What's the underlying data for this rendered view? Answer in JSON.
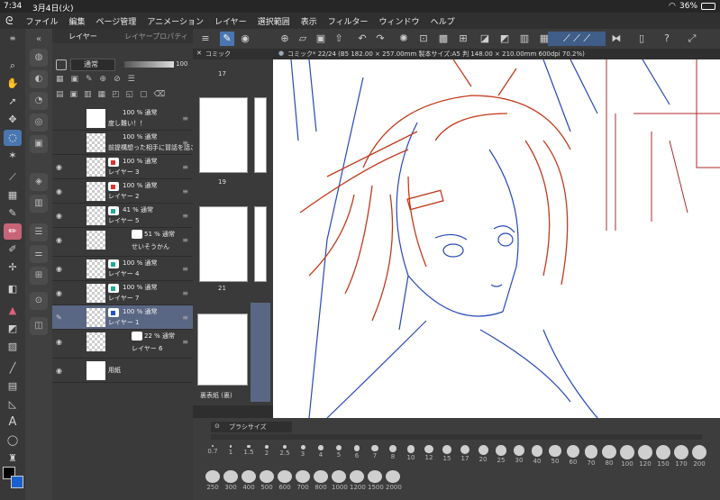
{
  "status": {
    "time": "7:34",
    "date": "3月4日(火)",
    "battery": "36%"
  },
  "menu": [
    "ファイル",
    "編集",
    "ページ管理",
    "アニメーション",
    "レイヤー",
    "選択範囲",
    "表示",
    "フィルター",
    "ウィンドウ",
    "ヘルプ"
  ],
  "layer_panel": {
    "tab_layer": "レイヤー",
    "tab_property": "レイヤープロパティ",
    "blend_mode": "通常",
    "opacity": "100"
  },
  "layers": [
    {
      "line1": "100 % 通常",
      "line2": "度し難い！！"
    },
    {
      "line1": "100 % 通常",
      "line2": "前提構想った相手に冒話を話させ"
    },
    {
      "line1": "100 % 通常",
      "line2": "レイヤー 3"
    },
    {
      "line1": "100 % 通常",
      "line2": "レイヤー 2"
    },
    {
      "line1": "41 % 通常",
      "line2": "レイヤー 5"
    },
    {
      "line1": "51 % 通常",
      "line2": "せいそうかん"
    },
    {
      "line1": "100 % 通常",
      "line2": "レイヤー 4"
    },
    {
      "line1": "100 % 通常",
      "line2": "レイヤー 7"
    },
    {
      "line1": "100 % 通常",
      "line2": "レイヤー 1"
    },
    {
      "line1": "22 % 通常",
      "line2": "レイヤー 6"
    },
    {
      "line1": "",
      "line2": "用紙"
    }
  ],
  "page_panel": {
    "tab": "コミック",
    "pages": [
      "17",
      "19",
      "21"
    ],
    "cover_label": "裏表紙 (裏)"
  },
  "canvas": {
    "tab_title": "コミック* 22/24 (B5 182.00 × 257.00mm 製本サイズ:A5 判 148.00 × 210.00mm 600dpi 70.2%)"
  },
  "brush": {
    "title": "ブラシサイズ",
    "sizes": [
      "0.7",
      "1",
      "1.5",
      "2",
      "2.5",
      "3",
      "4",
      "5",
      "6",
      "7",
      "8",
      "10",
      "12",
      "15",
      "17",
      "20",
      "25",
      "30",
      "40",
      "50",
      "60",
      "70",
      "80",
      "100",
      "120",
      "150",
      "170",
      "200"
    ],
    "sizes2": [
      "250",
      "300",
      "400",
      "500",
      "600",
      "700",
      "800",
      "1000",
      "1200",
      "1500",
      "2000"
    ]
  },
  "colors": {
    "accent": "#4a76b0",
    "main_color": "#000000",
    "sub_color": "#1a5fd0"
  }
}
